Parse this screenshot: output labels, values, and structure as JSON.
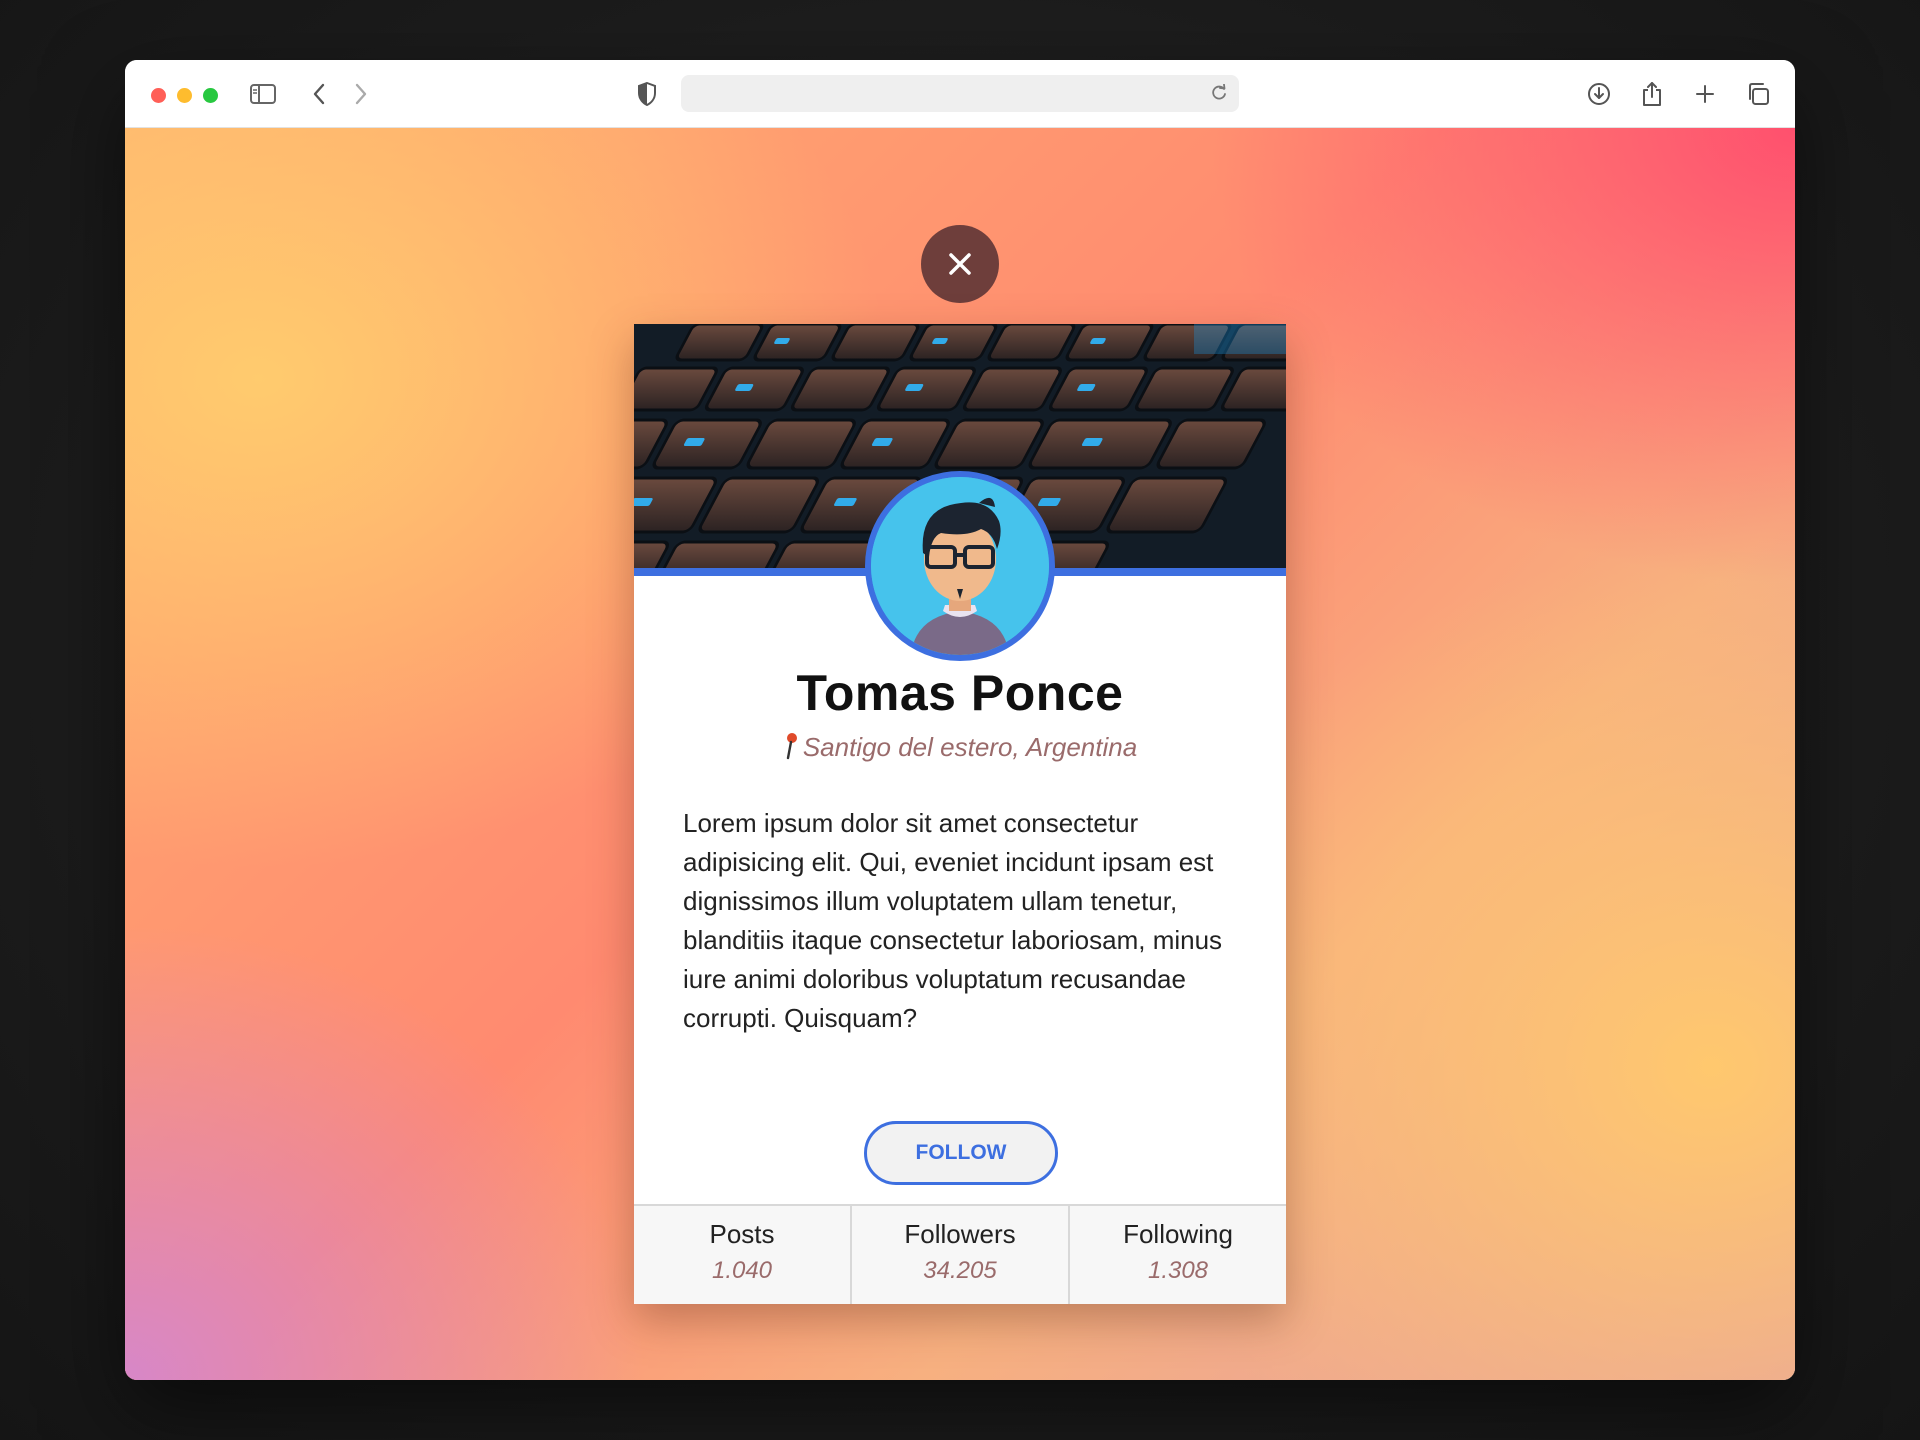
{
  "browser": {
    "address_value": "",
    "icons": [
      "sidebar-icon",
      "back-icon",
      "forward-icon",
      "shield-icon",
      "reload-icon",
      "download-icon",
      "share-icon",
      "new-tab-icon",
      "tabs-overview-icon"
    ]
  },
  "colors": {
    "accent": "#3d6fe0",
    "close_button": "#6e3e3b",
    "muted_text": "#9a6b6b"
  },
  "profile": {
    "name": "Tomas Ponce",
    "location": "Santigo del estero, Argentina",
    "bio": "Lorem ipsum dolor sit amet consectetur adipisicing elit. Qui, eveniet incidunt ipsam est dignissimos illum voluptatem ullam tenetur, blanditiis itaque consectetur laboriosam, minus iure animi doloribus voluptatum recusandae corrupti. Quisquam?",
    "follow_label": "FOLLOW",
    "stats": {
      "posts": {
        "label": "Posts",
        "value": "1.040"
      },
      "followers": {
        "label": "Followers",
        "value": "34.205"
      },
      "following": {
        "label": "Following",
        "value": "1.308"
      }
    }
  }
}
